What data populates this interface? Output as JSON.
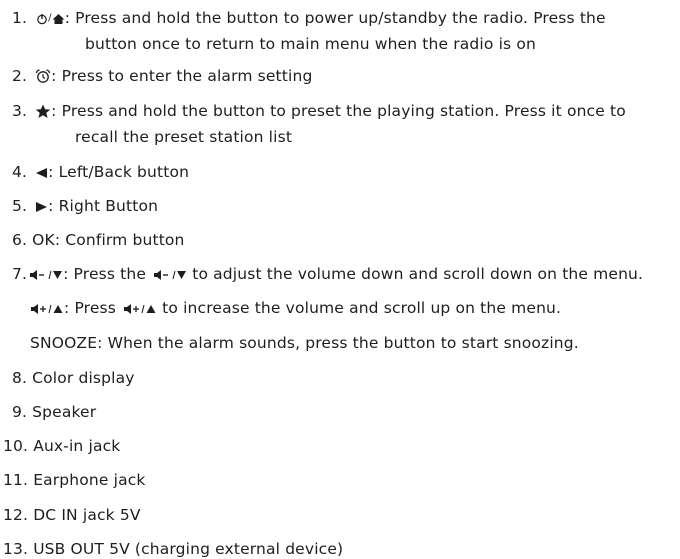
{
  "items": [
    {
      "num": "1.",
      "symbol": "⏻/🏠",
      "text": ": Press and hold the button to power up/standby the radio. Press the",
      "cont": "button once to return to main menu when the radio is on"
    },
    {
      "num": "2.",
      "symbol": "⏰",
      "text": ": Press to enter the alarm setting"
    },
    {
      "num": "3.",
      "symbol": "★",
      "text": ": Press and hold the button to preset the playing station. Press it once to",
      "cont": "recall the preset station list"
    },
    {
      "num": "4.",
      "symbol": "◀",
      "text": ": Left/Back button"
    },
    {
      "num": "5.",
      "symbol": "▶",
      "text": ": Right Button"
    },
    {
      "num": "6.",
      "text": "OK: Confirm button"
    },
    {
      "num": "7.",
      "symbol": "🔈-/▼",
      "text": ": Press the",
      "symbol_inline": "🔈-/▼",
      "text_after": "to adjust the volume down and scroll down on the menu."
    },
    {
      "symbol": "🔈+/▲",
      "text": ": Press",
      "symbol_inline": "🔈+/▲",
      "text_after": "to increase the volume and scroll up on the menu."
    },
    {
      "text": "SNOOZE: When the alarm sounds, press the button to start snoozing."
    },
    {
      "num": "8.",
      "text": "Color display"
    },
    {
      "num": "9.",
      "text": "Speaker"
    },
    {
      "num": "10.",
      "text": "Aux-in jack"
    },
    {
      "num": "11.",
      "text": "Earphone jack"
    },
    {
      "num": "12.",
      "text": "DC IN jack 5V"
    },
    {
      "num": "13.",
      "text": "USB OUT 5V (charging external device)"
    }
  ],
  "icons": {
    "power": "power-icon",
    "home": "home-icon",
    "alarm": "alarm-clock-icon",
    "star": "star-icon",
    "left": "left-triangle-icon",
    "right": "right-triangle-icon",
    "vol_down": "volume-down-icon",
    "vol_up": "volume-up-icon"
  },
  "colors": {
    "text": "#1e1e1e",
    "background": "#ffffff"
  }
}
